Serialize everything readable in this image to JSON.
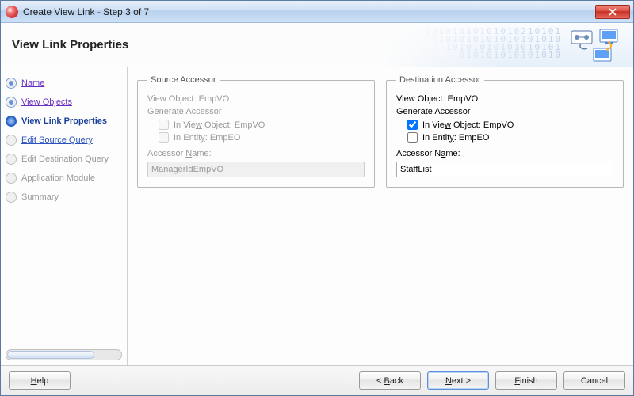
{
  "window": {
    "title": "Create View Link - Step 3 of 7"
  },
  "header": {
    "title": "View Link Properties"
  },
  "steps": [
    {
      "label": "Name",
      "state": "visited"
    },
    {
      "label": "View Objects",
      "state": "visited"
    },
    {
      "label": "View Link Properties",
      "state": "current"
    },
    {
      "label": "Edit Source Query",
      "state": "upcoming-link"
    },
    {
      "label": "Edit Destination Query",
      "state": "future"
    },
    {
      "label": "Application Module",
      "state": "future"
    },
    {
      "label": "Summary",
      "state": "future"
    }
  ],
  "source": {
    "legend": "Source Accessor",
    "viewObjectLabel": "View Object:",
    "viewObject": "EmpVO",
    "generateLabel": "Generate Accessor",
    "inViewObject": {
      "prefix": "In Vie",
      "u": "w",
      "suffix": " Object: EmpVO",
      "checked": false
    },
    "inEntity": {
      "prefix": "In Entit",
      "u": "y",
      "suffix": ": EmpEO",
      "checked": false
    },
    "accessorLabel": {
      "prefix": "Accessor ",
      "u": "N",
      "suffix": "ame:"
    },
    "accessorValue": "ManagerIdEmpVO",
    "enabled": false
  },
  "dest": {
    "legend": "Destination Accessor",
    "viewObjectLabel": "View Object:",
    "viewObject": "EmpVO",
    "generateLabel": "Generate Accessor",
    "inViewObject": {
      "prefix": "In Vie",
      "u": "w",
      "suffix": " Object: EmpVO",
      "checked": true
    },
    "inEntity": {
      "prefix": "In Entit",
      "u": "y",
      "suffix": ": EmpEO",
      "checked": false
    },
    "accessorLabel": {
      "prefix": "Accessor N",
      "u": "a",
      "suffix": "me:"
    },
    "accessorValue": "StaffList",
    "enabled": true
  },
  "buttons": {
    "help": "Help",
    "back": "< Back",
    "next": "Next >",
    "finish": "Finish",
    "cancel": "Cancel",
    "helpU": "H",
    "backU": "B",
    "nextU": "N",
    "finishU": "F"
  }
}
